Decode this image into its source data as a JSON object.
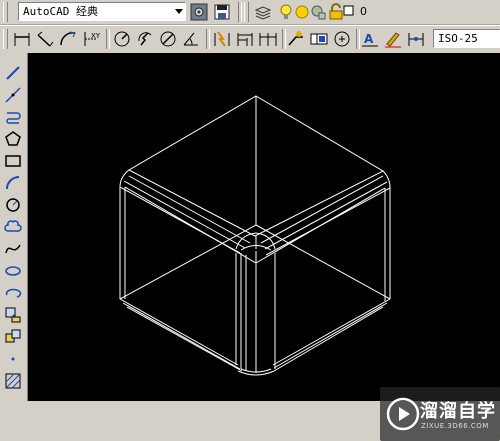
{
  "workspace": {
    "selected": "AutoCAD 经典"
  },
  "layer": {
    "current": "0"
  },
  "dimstyle": {
    "current": "ISO-25"
  },
  "watermark": {
    "brand": "溜溜自学",
    "url": "ZIXUE.3D66.COM"
  },
  "colors": {
    "canvas": "#000000",
    "drawing_lines": "#ffffff",
    "toolbar_bg": "#d4d0c8"
  }
}
